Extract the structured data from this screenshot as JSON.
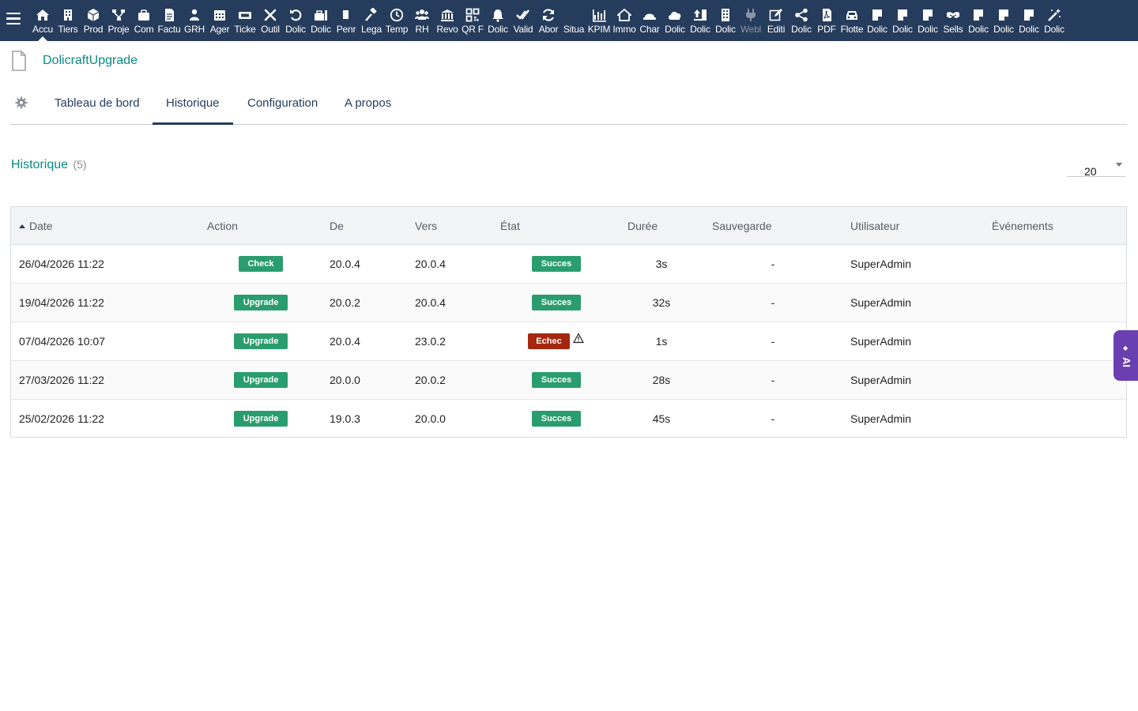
{
  "topbar": {
    "items": [
      {
        "label": "Accu",
        "icon": "home-icon"
      },
      {
        "label": "Tiers",
        "icon": "building-icon"
      },
      {
        "label": "Prod",
        "icon": "cube-icon"
      },
      {
        "label": "Proje",
        "icon": "sitemap-icon"
      },
      {
        "label": "Com",
        "icon": "briefcase-icon"
      },
      {
        "label": "Factu",
        "icon": "invoice-icon"
      },
      {
        "label": "GRH",
        "icon": "user-group-icon"
      },
      {
        "label": "Ager",
        "icon": "calendar-icon"
      },
      {
        "label": "Ticke",
        "icon": "ticket-icon"
      },
      {
        "label": "Outil",
        "icon": "tools-icon"
      },
      {
        "label": "Dolic",
        "icon": "undo-icon"
      },
      {
        "label": "Dolic",
        "icon": "toolbox-icon"
      },
      {
        "label": "Penr",
        "icon": "file-icon"
      },
      {
        "label": "Lega",
        "icon": "gavel-icon"
      },
      {
        "label": "Temp",
        "icon": "clock-icon"
      },
      {
        "label": "RH",
        "icon": "users-icon"
      },
      {
        "label": "Revo",
        "icon": "institution-icon"
      },
      {
        "label": "QR F",
        "icon": "qrcode-icon"
      },
      {
        "label": "Dolic",
        "icon": "bell-icon"
      },
      {
        "label": "Valid",
        "icon": "double-check-icon"
      },
      {
        "label": "Abor",
        "icon": "refresh-icon"
      },
      {
        "label": "Situa",
        "icon": "blank-icon"
      },
      {
        "label": "KPIM",
        "icon": "bar-chart-icon"
      },
      {
        "label": "Immo",
        "icon": "house-icon"
      },
      {
        "label": "Char",
        "icon": "hard-hat-icon"
      },
      {
        "label": "Dolic",
        "icon": "cloud-icon"
      },
      {
        "label": "Dolic",
        "icon": "upload-icon"
      },
      {
        "label": "Dolic",
        "icon": "office-building-icon"
      },
      {
        "label": "Webl",
        "icon": "plug-icon"
      },
      {
        "label": "Editi",
        "icon": "edit-icon"
      },
      {
        "label": "Dolic",
        "icon": "share-icon"
      },
      {
        "label": "PDF",
        "icon": "pdf-icon"
      },
      {
        "label": "Flotte",
        "icon": "car-icon"
      },
      {
        "label": "Dolic",
        "icon": "note-icon"
      },
      {
        "label": "Dolic",
        "icon": "note-icon"
      },
      {
        "label": "Dolic",
        "icon": "note-icon"
      },
      {
        "label": "Sells",
        "icon": "handshake-icon"
      },
      {
        "label": "Dolic",
        "icon": "note-icon"
      },
      {
        "label": "Dolic",
        "icon": "note-icon"
      },
      {
        "label": "Dolic",
        "icon": "note-icon"
      },
      {
        "label": "Dolic",
        "icon": "magic-wand-icon"
      }
    ]
  },
  "header": {
    "module_title": "DolicraftUpgrade"
  },
  "tabs": [
    {
      "label": "Tableau de bord"
    },
    {
      "label": "Historique"
    },
    {
      "label": "Configuration"
    },
    {
      "label": "A propos"
    }
  ],
  "section": {
    "title": "Historique",
    "count": "(5)",
    "per_page": "20"
  },
  "table": {
    "columns": [
      "Date",
      "Action",
      "De",
      "Vers",
      "État",
      "Durée",
      "Sauvegarde",
      "Utilisateur",
      "Événements"
    ],
    "rows": [
      {
        "date": "26/04/2026 11:22",
        "action": "Check",
        "from": "20.0.4",
        "to": "20.0.4",
        "status": "Succes",
        "duration": "3s",
        "backup": "-",
        "user": "SuperAdmin",
        "events": ""
      },
      {
        "date": "19/04/2026 11:22",
        "action": "Upgrade",
        "from": "20.0.2",
        "to": "20.0.4",
        "status": "Succes",
        "duration": "32s",
        "backup": "-",
        "user": "SuperAdmin",
        "events": ""
      },
      {
        "date": "07/04/2026 10:07",
        "action": "Upgrade",
        "from": "20.0.4",
        "to": "23.0.2",
        "status": "Echec",
        "duration": "1s",
        "backup": "-",
        "user": "SuperAdmin",
        "events": ""
      },
      {
        "date": "27/03/2026 11:22",
        "action": "Upgrade",
        "from": "20.0.0",
        "to": "20.0.2",
        "status": "Succes",
        "duration": "28s",
        "backup": "-",
        "user": "SuperAdmin",
        "events": ""
      },
      {
        "date": "25/02/2026 11:22",
        "action": "Upgrade",
        "from": "19.0.3",
        "to": "20.0.0",
        "status": "Succes",
        "duration": "45s",
        "backup": "-",
        "user": "SuperAdmin",
        "events": ""
      }
    ]
  },
  "ai_tab": {
    "label": "AI"
  },
  "colors": {
    "topbar": "#263c5c",
    "accent_teal": "#0a8a82",
    "success": "#2a9d6f",
    "failure": "#a5270f",
    "ai": "#6a3fb0"
  }
}
